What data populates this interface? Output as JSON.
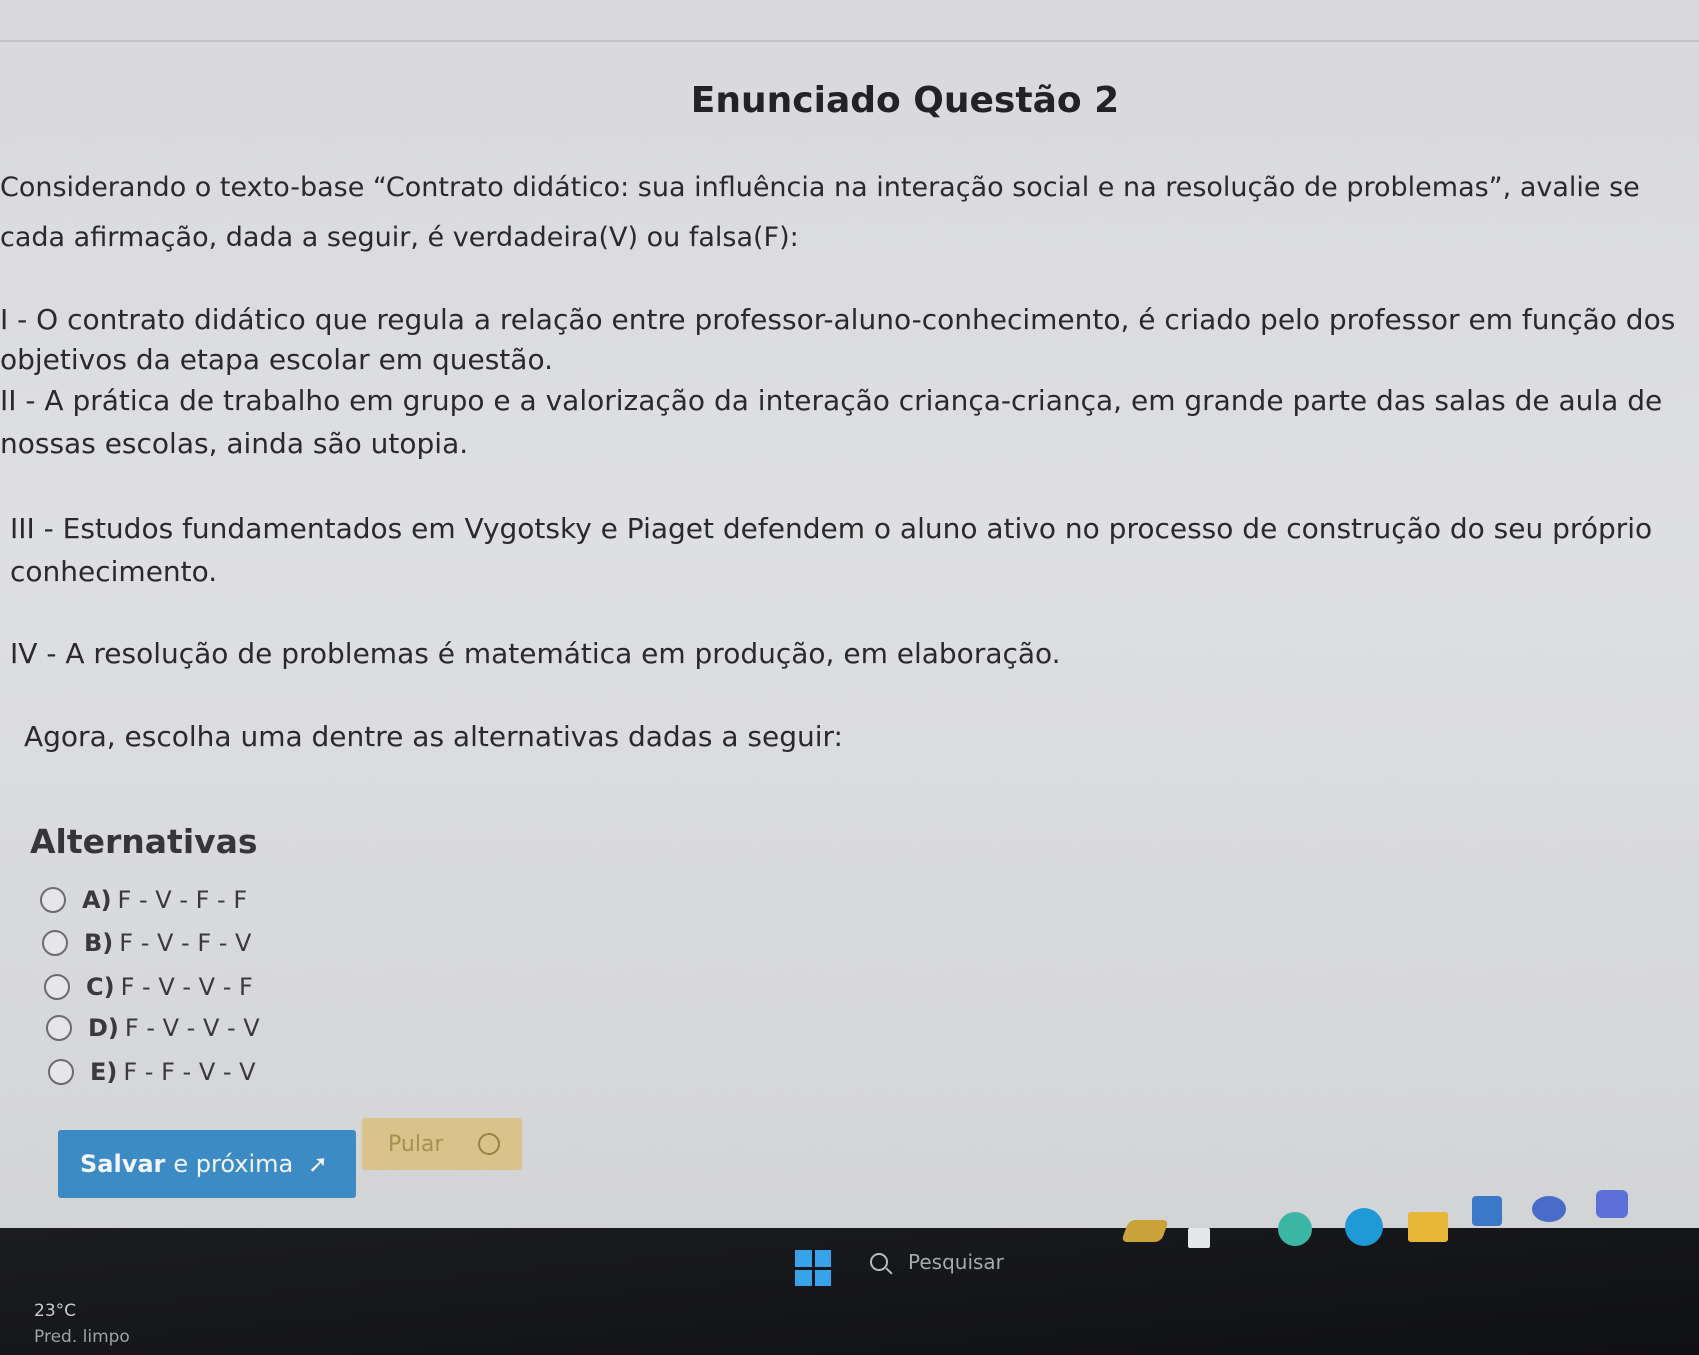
{
  "question": {
    "title": "Enunciado Questão 2",
    "intro": [
      "Considerando o texto-base “Contrato didático: sua influência na interação social e na resolução de problemas”, avalie se",
      "cada afirmação, dada a seguir, é verdadeira(V) ou falsa(F):"
    ],
    "statement_1": [
      "I - O contrato didático que regula a relação entre professor-aluno-conhecimento, é criado pelo professor em função dos",
      "objetivos da etapa escolar em questão."
    ],
    "statement_2": [
      "II - A prática de trabalho em grupo e a valorização da interação criança-criança, em grande parte das salas de aula de",
      "nossas escolas, ainda são utopia."
    ],
    "statement_3": [
      "III - Estudos fundamentados em Vygotsky e Piaget defendem o aluno ativo no processo de construção do seu próprio",
      "conhecimento."
    ],
    "statement_4": "IV - A resolução de problemas é matemática em produção, em elaboração.",
    "prompt": "Agora, escolha uma dentre as alternativas dadas a seguir:"
  },
  "alternatives": {
    "title": "Alternativas",
    "options": [
      {
        "letter": "A)",
        "text": "F - V - F - F"
      },
      {
        "letter": "B)",
        "text": "F - V - F - V"
      },
      {
        "letter": "C)",
        "text": "F - V - V - F"
      },
      {
        "letter": "D)",
        "text": "F - V - V - V"
      },
      {
        "letter": "E)",
        "text": "F - F - V - V"
      }
    ]
  },
  "actions": {
    "save_bold": "Salvar",
    "save_rest": "e próxima",
    "save_arrow": "➚",
    "skip": "Pular"
  },
  "taskbar": {
    "temperature": "23°C",
    "weather": "Pred. limpo",
    "search_placeholder": "Pesquisar"
  }
}
